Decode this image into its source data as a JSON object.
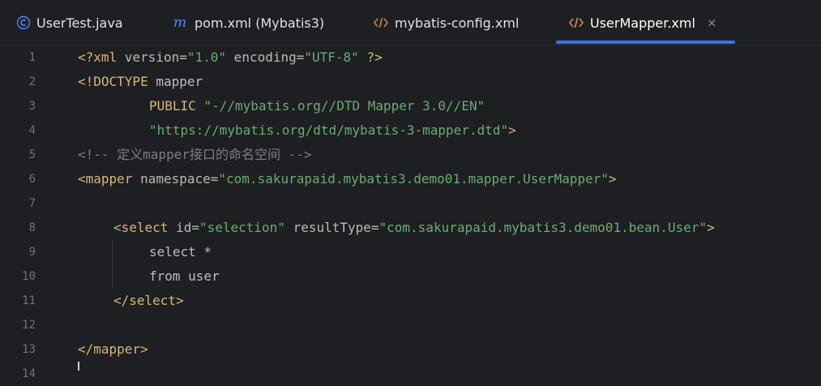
{
  "tabs": [
    {
      "label": "UserTest.java",
      "icon": "java-class-icon",
      "active": false
    },
    {
      "label": "pom.xml (Mybatis3)",
      "icon": "maven-icon",
      "active": false
    },
    {
      "label": "mybatis-config.xml",
      "icon": "xml-file-icon",
      "active": false
    },
    {
      "label": "UserMapper.xml",
      "icon": "xml-file-icon",
      "active": true,
      "close": "×"
    }
  ],
  "colors": {
    "background": "#1e1f22",
    "tag": "#d5b778",
    "string": "#6aab73",
    "comment": "#7a7e85",
    "text": "#bcbec4",
    "line_number": "#6f737a",
    "accent": "#3574f0"
  },
  "line_numbers": [
    "1",
    "2",
    "3",
    "4",
    "5",
    "6",
    "7",
    "8",
    "9",
    "10",
    "11",
    "12",
    "13",
    "14"
  ],
  "code": {
    "l1": {
      "tag": "<?xml",
      "a1": " version=",
      "s1": "\"1.0\"",
      "a2": " encoding=",
      "s2": "\"UTF-8\"",
      "end": " ?>"
    },
    "l2": {
      "tag": "<!DOCTYPE",
      "rest": " mapper"
    },
    "l3": {
      "kw": "PUBLIC",
      "s": " \"-//mybatis.org//DTD Mapper 3.0//EN\""
    },
    "l4": {
      "s": "\"https://mybatis.org/dtd/mybatis-3-mapper.dtd\"",
      "end": ">"
    },
    "l5": {
      "comment": "<!-- 定义mapper接口的命名空间 -->"
    },
    "l6": {
      "tag": "<mapper",
      "a": " namespace=",
      "s": "\"com.sakurapaid.mybatis3.demo01.mapper.UserMapper\"",
      "end": ">"
    },
    "l8": {
      "tag": "<select",
      "a1": " id=",
      "s1": "\"selection\"",
      "a2": " resultType=",
      "s2": "\"com.sakurapaid.mybatis3.demo01.bean.User\"",
      "end": ">"
    },
    "l9": {
      "text": "select *"
    },
    "l10": {
      "text": "from user"
    },
    "l11": {
      "tag": "</select>"
    },
    "l13": {
      "tag": "</mapper>"
    }
  }
}
